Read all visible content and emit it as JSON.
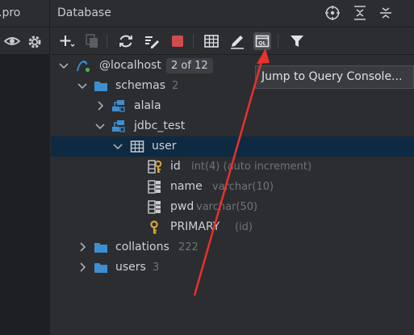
{
  "left_panel": {
    "tab_title": ".pro"
  },
  "database_panel": {
    "title": "Database",
    "header_icons": [
      "target-icon",
      "collapse-all-icon",
      "expand-all-icon"
    ],
    "toolbar_icons": [
      "add-icon",
      "copy-icon",
      "refresh-icon",
      "schema-edit-icon",
      "stop-icon",
      "table-icon",
      "edit-icon",
      "query-console-icon",
      "filter-icon"
    ]
  },
  "tooltip": {
    "text": "Jump to Query Console..."
  },
  "tree": {
    "root": {
      "label": "@localhost",
      "badge": "2 of 12"
    },
    "schemas": {
      "label": "schemas",
      "count": "2"
    },
    "schema_alala": {
      "label": "alala"
    },
    "schema_jdbc": {
      "label": "jdbc_test"
    },
    "table_user": {
      "label": "user"
    },
    "columns": [
      {
        "name": "id",
        "type": "int(4) (auto increment)"
      },
      {
        "name": "name",
        "type": "varchar(10)"
      },
      {
        "name": "pwd",
        "type": "varchar(50)"
      }
    ],
    "key": {
      "name": "PRIMARY",
      "detail": "(id)"
    },
    "collations": {
      "label": "collations",
      "count": "222"
    },
    "users": {
      "label": "users",
      "count": "3"
    }
  },
  "colors": {
    "background": "#2b2d30",
    "selection": "#0d2a42",
    "folder_blue": "#3d8fd1",
    "key_gold": "#d9a343",
    "stop_red": "#d04c4c",
    "annotation_red": "#e8312b"
  }
}
